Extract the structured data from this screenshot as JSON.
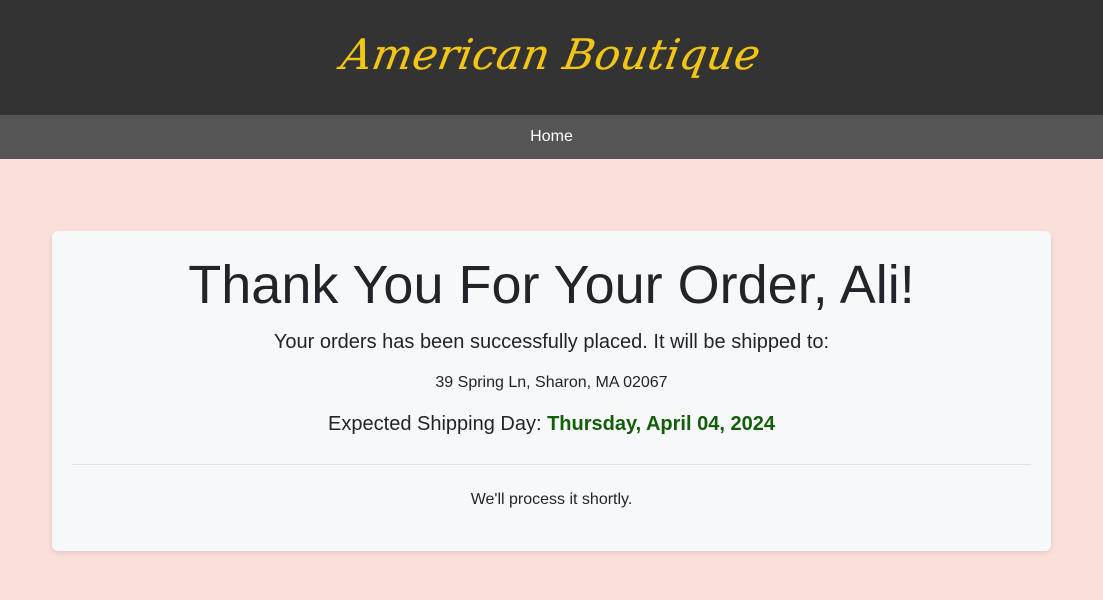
{
  "header": {
    "brand": "American Boutique",
    "brand_color": "#f3c614",
    "background_color": "#333333"
  },
  "nav": {
    "items": [
      {
        "label": "Home"
      }
    ],
    "background_color": "#555555"
  },
  "confirmation": {
    "title": "Thank You For Your Order, Ali!",
    "message": "Your orders has been successfully placed. It will be shipped to:",
    "address": "39 Spring Ln, Sharon, MA 02067",
    "shipping_label": "Expected Shipping Day:",
    "shipping_date": "Thursday, April 04, 2024",
    "shipping_date_color": "#135e08",
    "footer_text": "We'll process it shortly."
  },
  "page_background_color": "#fbdfdb"
}
